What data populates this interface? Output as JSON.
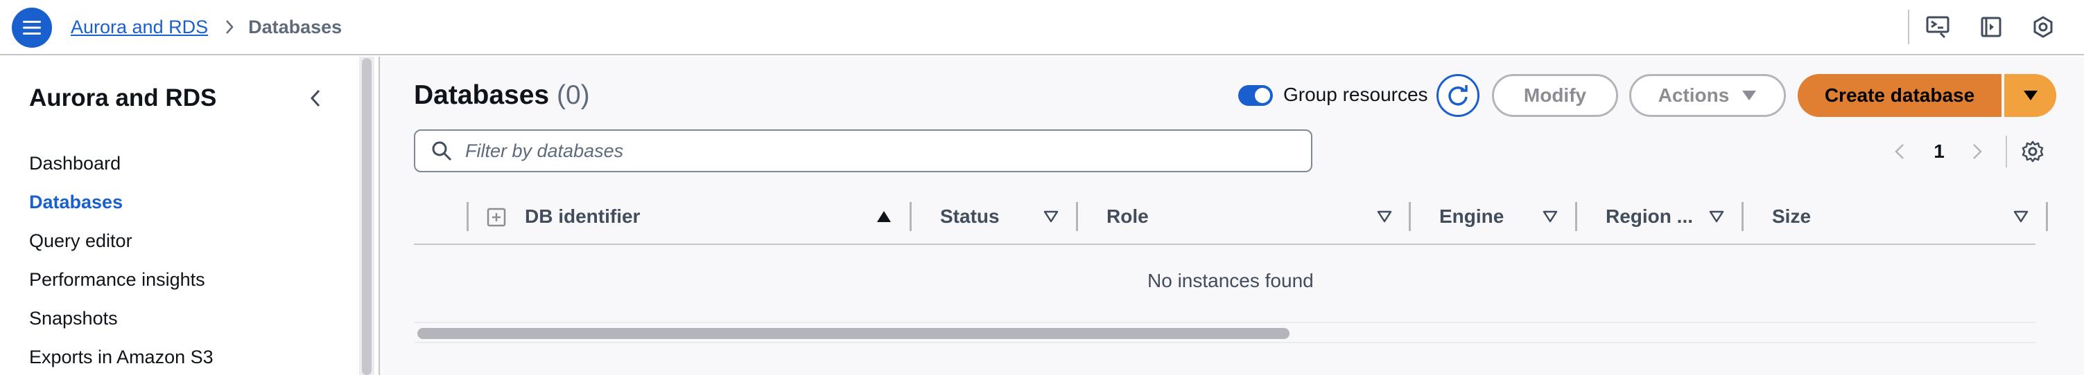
{
  "header": {
    "breadcrumb_parent": "Aurora and RDS",
    "breadcrumb_current": "Databases",
    "icons": [
      "menu-icon",
      "cloudshell-icon",
      "notifications-panel-icon",
      "settings-hexagon-icon"
    ]
  },
  "sidebar": {
    "title": "Aurora and RDS",
    "items": [
      {
        "label": "Dashboard",
        "active": false
      },
      {
        "label": "Databases",
        "active": true
      },
      {
        "label": "Query editor",
        "active": false
      },
      {
        "label": "Performance insights",
        "active": false
      },
      {
        "label": "Snapshots",
        "active": false
      },
      {
        "label": "Exports in Amazon S3",
        "active": false
      }
    ]
  },
  "main": {
    "title": "Databases",
    "count": "(0)",
    "group_resources_label": "Group resources",
    "group_resources_on": true,
    "modify_label": "Modify",
    "actions_label": "Actions",
    "create_label": "Create database",
    "filter_placeholder": "Filter by databases",
    "page_number": "1"
  },
  "table": {
    "columns": [
      "DB identifier",
      "Status",
      "Role",
      "Engine",
      "Region ...",
      "Size"
    ],
    "empty_message": "No instances found"
  },
  "colors": {
    "accent": "#1a5fce",
    "primary_button": "#e07e31",
    "primary_button_dropdown": "#f2a13f"
  }
}
